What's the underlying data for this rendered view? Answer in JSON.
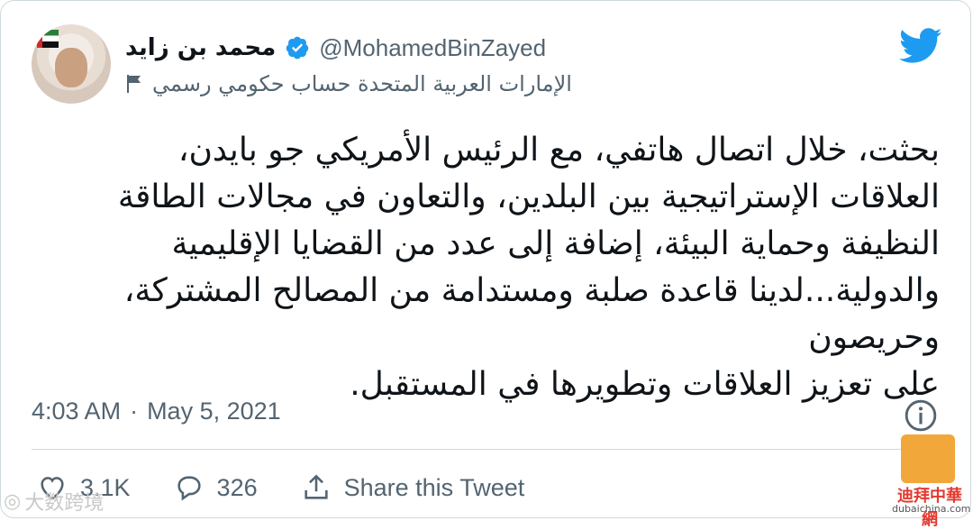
{
  "header": {
    "display_name": "محمد بن زايد",
    "handle": "@MohamedBinZayed",
    "label": "الإمارات العربية المتحدة حساب حكومي رسمي"
  },
  "tweet": {
    "text": "بحثت، خلال اتصال هاتفي، مع الرئيس الأمريكي جو بايدن،\nالعلاقات الإستراتيجية بين البلدين، والتعاون في مجالات الطاقة\nالنظيفة وحماية البيئة، إضافة إلى عدد من القضايا الإقليمية\nوالدولية...لدينا قاعدة صلبة ومستدامة من المصالح المشتركة،\nوحريصون\nعلى تعزيز العلاقات وتطويرها في المستقبل."
  },
  "meta": {
    "time": "4:03 AM",
    "separator": "·",
    "date": "May 5, 2021"
  },
  "actions": {
    "likes": "3.1K",
    "replies": "326",
    "share_label": "Share this Tweet"
  },
  "watermarks": {
    "left": "大数跨境",
    "right_cn": "迪拜中華網",
    "right_url": "dubaichina.com"
  },
  "colors": {
    "accent": "#1d9bf0",
    "secondary_text": "#536471",
    "divider": "#cfd9de"
  }
}
